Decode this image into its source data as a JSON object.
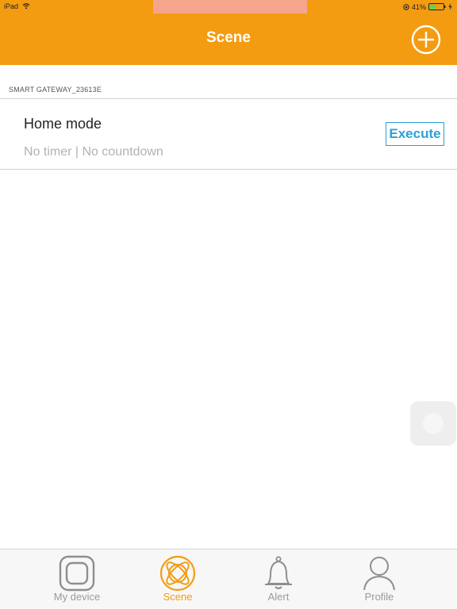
{
  "status_bar": {
    "carrier": "iPad",
    "battery_percent": "41%",
    "icons": [
      "wifi-icon",
      "orientation-lock-icon",
      "battery-icon",
      "charging-icon"
    ]
  },
  "header": {
    "title": "Scene",
    "add_icon": "plus-circle-icon",
    "color": "#f39c12"
  },
  "section": {
    "label": "SMART GATEWAY_23613E"
  },
  "scenes": [
    {
      "name": "Home mode",
      "subtitle": "No timer | No countdown",
      "action_label": "Execute",
      "action_color": "#2aa0d6"
    }
  ],
  "tabs": [
    {
      "label": "My device",
      "icon": "device-icon",
      "active": false
    },
    {
      "label": "Scene",
      "icon": "scene-icon",
      "active": true
    },
    {
      "label": "Alert",
      "icon": "bell-icon",
      "active": false
    },
    {
      "label": "Profile",
      "icon": "person-icon",
      "active": false
    }
  ],
  "colors": {
    "accent": "#f39c12",
    "tab_inactive": "#9a9a9a",
    "execute": "#2aa0d6"
  }
}
